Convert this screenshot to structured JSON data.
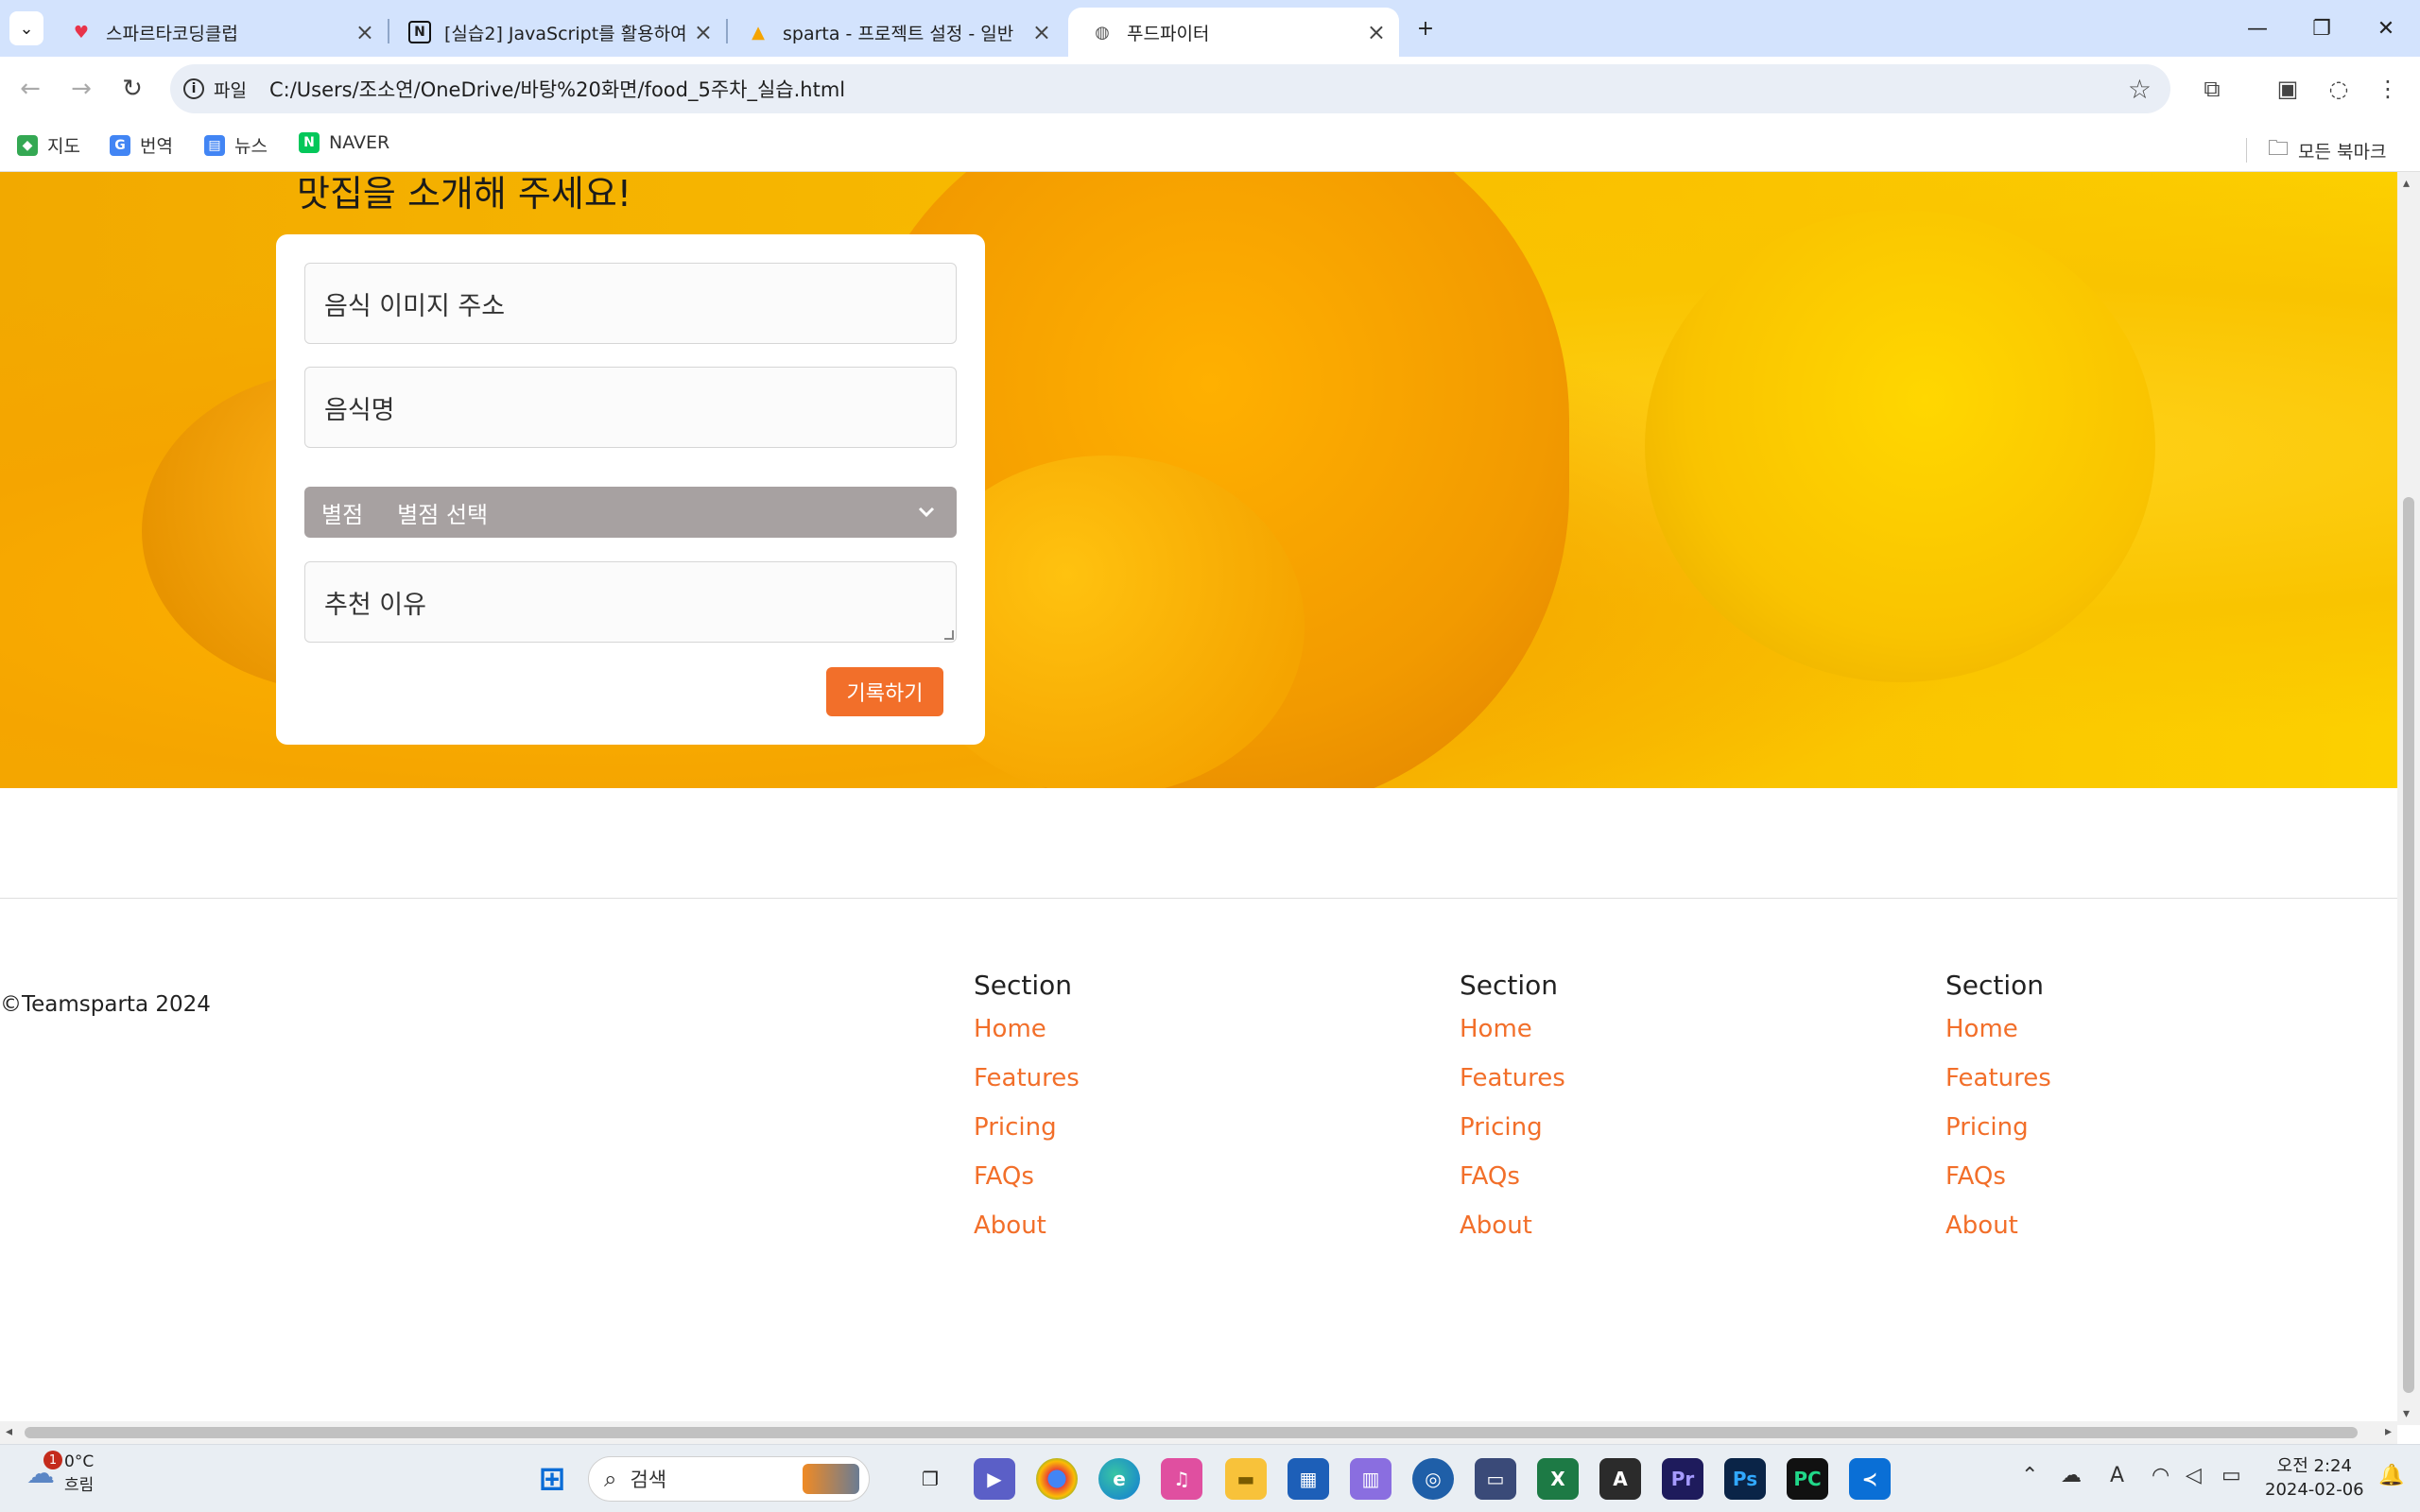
{
  "browser": {
    "tabs": [
      {
        "title": "스파르타코딩클럽",
        "favicon": "heart-icon"
      },
      {
        "title": "[실습2] JavaScript를 활용하여",
        "favicon": "notion-icon"
      },
      {
        "title": "sparta - 프로젝트 설정 - 일반",
        "favicon": "firebase-icon"
      },
      {
        "title": "푸드파이터",
        "favicon": "globe-icon"
      }
    ],
    "new_tab": "+",
    "address": {
      "scheme_label": "파일",
      "url": "C:/Users/조소연/OneDrive/바탕%20화면/food_5주차_실습.html"
    },
    "bookmarks": [
      {
        "label": "지도",
        "color": "#34a853"
      },
      {
        "label": "번역",
        "color": "#4285f4"
      },
      {
        "label": "뉴스",
        "color": "#4285f4"
      },
      {
        "label": "NAVER",
        "color": "#03c75a"
      }
    ],
    "all_bookmarks": "모든 북마크"
  },
  "page": {
    "hero_title": "맛집을 소개해 주세요!",
    "form": {
      "image_placeholder": "음식 이미지 주소",
      "name_placeholder": "음식명",
      "rating_label": "별점",
      "rating_value": "별점 선택",
      "reason_placeholder": "추천 이유",
      "submit_label": "기록하기"
    },
    "footer": {
      "copyright": "©Teamsparta 2024",
      "columns": [
        {
          "heading": "Section",
          "links": [
            "Home",
            "Features",
            "Pricing",
            "FAQs",
            "About"
          ]
        },
        {
          "heading": "Section",
          "links": [
            "Home",
            "Features",
            "Pricing",
            "FAQs",
            "About"
          ]
        },
        {
          "heading": "Section",
          "links": [
            "Home",
            "Features",
            "Pricing",
            "FAQs",
            "About"
          ]
        }
      ]
    },
    "accent_color": "#f26f2a"
  },
  "taskbar": {
    "weather": {
      "temp": "0°C",
      "condition": "흐림",
      "badge": "1"
    },
    "search_label": "검색",
    "clock": {
      "time": "오전 2:24",
      "date": "2024-02-06"
    },
    "apps": [
      "start-icon",
      "search",
      "widgets",
      "task-view",
      "teams",
      "chrome",
      "edge",
      "app-purple",
      "file-explorer",
      "store",
      "app-violet",
      "app-circle",
      "app-remote",
      "excel",
      "acrobat",
      "premiere",
      "photoshop",
      "pycharm",
      "vscode"
    ]
  }
}
